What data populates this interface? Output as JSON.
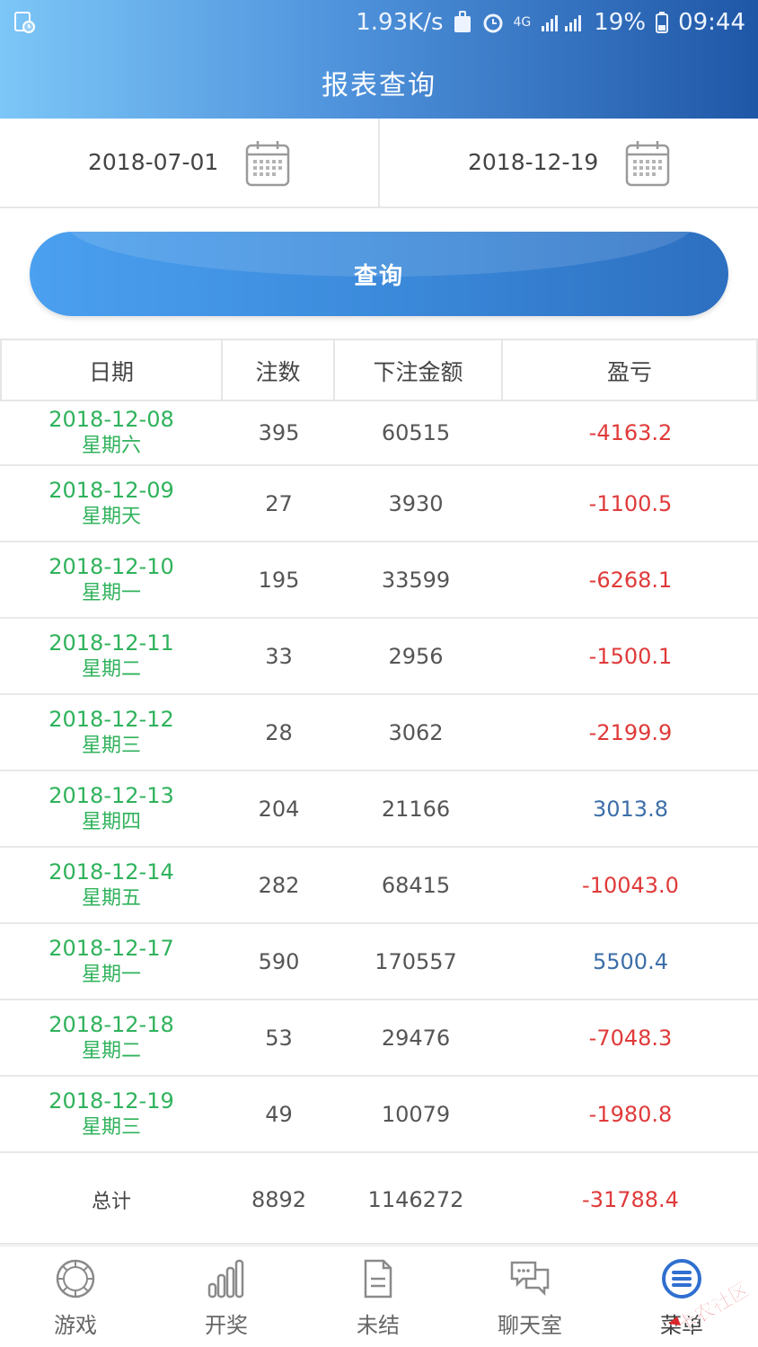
{
  "status_bar": {
    "speed": "1.93K/s",
    "network": "4G",
    "battery": "19%",
    "time": "09:44"
  },
  "header": {
    "title": "报表查询"
  },
  "dates": {
    "start": "2018-07-01",
    "end": "2018-12-19"
  },
  "query_button": {
    "label": "查询"
  },
  "table": {
    "columns": [
      "日期",
      "注数",
      "下注金额",
      "盈亏"
    ],
    "rows": [
      {
        "date": "2018-12-08",
        "weekday": "星期六",
        "count": "395",
        "amount": "60515",
        "pl": "-4163.2",
        "type": "neg"
      },
      {
        "date": "2018-12-09",
        "weekday": "星期天",
        "count": "27",
        "amount": "3930",
        "pl": "-1100.5",
        "type": "neg"
      },
      {
        "date": "2018-12-10",
        "weekday": "星期一",
        "count": "195",
        "amount": "33599",
        "pl": "-6268.1",
        "type": "neg"
      },
      {
        "date": "2018-12-11",
        "weekday": "星期二",
        "count": "33",
        "amount": "2956",
        "pl": "-1500.1",
        "type": "neg"
      },
      {
        "date": "2018-12-12",
        "weekday": "星期三",
        "count": "28",
        "amount": "3062",
        "pl": "-2199.9",
        "type": "neg"
      },
      {
        "date": "2018-12-13",
        "weekday": "星期四",
        "count": "204",
        "amount": "21166",
        "pl": "3013.8",
        "type": "pos"
      },
      {
        "date": "2018-12-14",
        "weekday": "星期五",
        "count": "282",
        "amount": "68415",
        "pl": "-10043.0",
        "type": "neg"
      },
      {
        "date": "2018-12-17",
        "weekday": "星期一",
        "count": "590",
        "amount": "170557",
        "pl": "5500.4",
        "type": "pos"
      },
      {
        "date": "2018-12-18",
        "weekday": "星期二",
        "count": "53",
        "amount": "29476",
        "pl": "-7048.3",
        "type": "neg"
      },
      {
        "date": "2018-12-19",
        "weekday": "星期三",
        "count": "49",
        "amount": "10079",
        "pl": "-1980.8",
        "type": "neg"
      }
    ],
    "totals": {
      "label": "总计",
      "count": "8892",
      "amount": "1146272",
      "pl": "-31788.4"
    }
  },
  "bottom_nav": [
    {
      "label": "游戏",
      "icon": "roulette-icon"
    },
    {
      "label": "开奖",
      "icon": "bar-chart-icon"
    },
    {
      "label": "未结",
      "icon": "document-icon"
    },
    {
      "label": "聊天室",
      "icon": "chat-icon"
    },
    {
      "label": "菜单",
      "icon": "menu-icon"
    }
  ],
  "watermark": "卡农社区",
  "colors": {
    "header_start": "#7cc6f7",
    "header_end": "#1f57a7",
    "date_green": "#2fb25b",
    "negative": "#e03a3a",
    "positive": "#3c6ea8"
  }
}
